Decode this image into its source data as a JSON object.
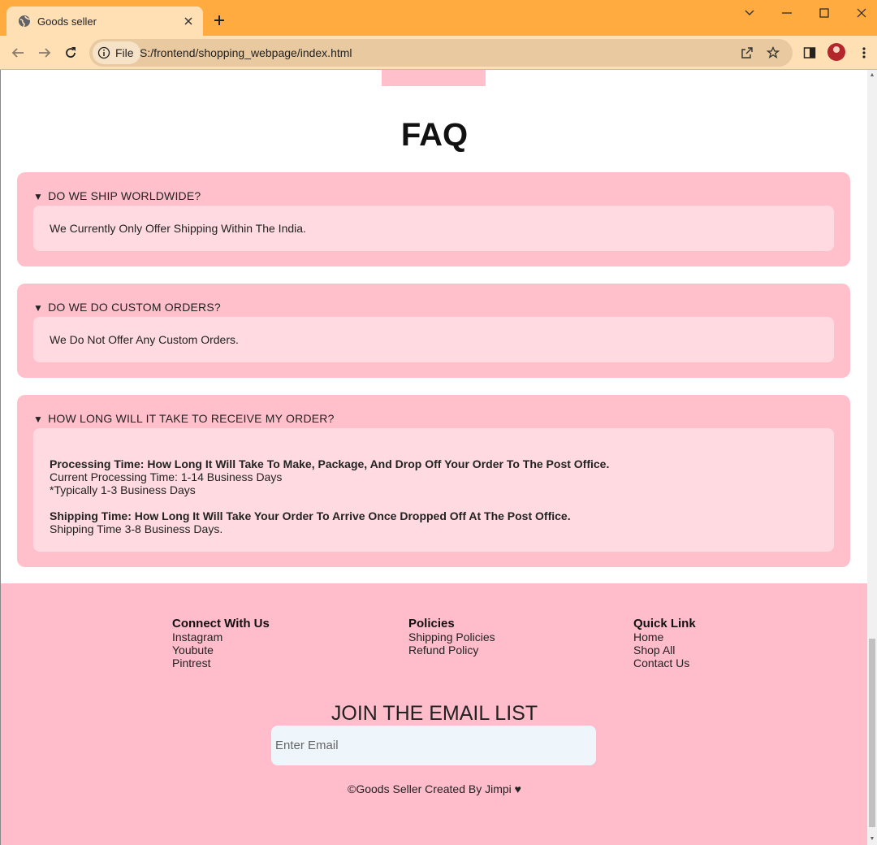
{
  "browser": {
    "tab_title": "Goods seller",
    "file_chip": "File",
    "url": "S:/frontend/shopping_webpage/index.html"
  },
  "faq": {
    "title": "FAQ",
    "arrow": "▼",
    "items": [
      {
        "question": "DO WE SHIP WORLDWIDE?",
        "answer": "We Currently Only Offer Shipping Within The India."
      },
      {
        "question": "DO WE DO CUSTOM ORDERS?",
        "answer": "We Do Not Offer Any Custom Orders."
      },
      {
        "question": "HOW LONG WILL IT TAKE TO RECEIVE MY ORDER?",
        "processing_heading": "Processing Time: How Long It Will Take To Make, Package, And Drop Off Your Order To The Post Office.",
        "processing_line1": "Current Processing Time: 1-14 Business Days",
        "processing_line2": "*Typically 1-3 Business Days",
        "shipping_heading": "Shipping Time: How Long It Will Take Your Order To Arrive Once Dropped Off At The Post Office.",
        "shipping_line1": "Shipping Time 3-8 Business Days."
      }
    ]
  },
  "footer": {
    "connect": {
      "heading": "Connect With Us",
      "links": [
        "Instagram",
        "Youbute",
        "Pintrest"
      ]
    },
    "policies": {
      "heading": "Policies",
      "links": [
        "Shipping Policies",
        "Refund Policy"
      ]
    },
    "quick": {
      "heading": "Quick Link",
      "links": [
        "Home",
        "Shop All",
        "Contact Us"
      ]
    },
    "email_title": "JOIN THE EMAIL LIST",
    "email_placeholder": "Enter Email",
    "copyright": "©Goods Seller Created By Jimpi ♥"
  },
  "colors": {
    "title_bar": "#ffab40",
    "toolbar": "#ffdfb4",
    "card_pink": "#ffc0cb",
    "answer_pink": "#ffdbe1",
    "footer_pink": "#ffbccb",
    "email_bg": "#eef6fc"
  }
}
